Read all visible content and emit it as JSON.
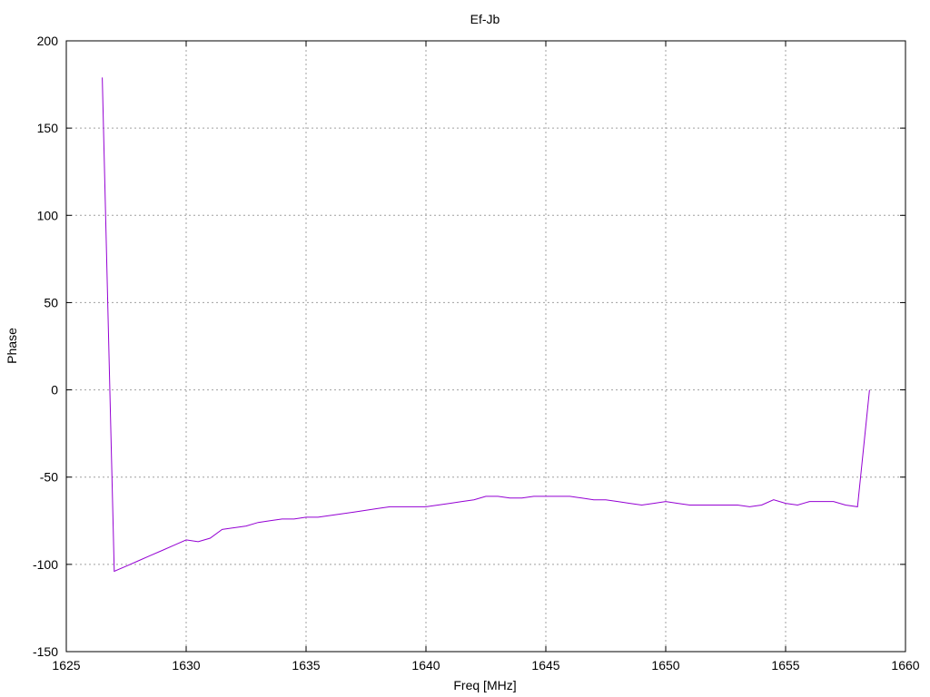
{
  "chart_data": {
    "type": "line",
    "title": "Ef-Jb",
    "xlabel": "Freq [MHz]",
    "ylabel": "Phase",
    "xlim": [
      1625,
      1660
    ],
    "ylim": [
      -150,
      200
    ],
    "xticks": [
      1625,
      1630,
      1635,
      1640,
      1645,
      1650,
      1655,
      1660
    ],
    "yticks": [
      -150,
      -100,
      -50,
      0,
      50,
      100,
      150,
      200
    ],
    "xtick_labels": [
      "1625",
      "1630",
      "1635",
      "1640",
      "1645",
      "1650",
      "1655",
      "1660"
    ],
    "ytick_labels": [
      "-150",
      "-100",
      "-50",
      "0",
      "50",
      "100",
      "150",
      "200"
    ],
    "grid": true,
    "line_color": "#9400d3",
    "series": [
      {
        "x": [
          1626.5,
          1627.0,
          1627.5,
          1628.0,
          1628.5,
          1629.0,
          1629.5,
          1630.0,
          1630.5,
          1631.0,
          1631.5,
          1632.0,
          1632.5,
          1633.0,
          1633.5,
          1634.0,
          1634.5,
          1635.0,
          1635.5,
          1636.0,
          1636.5,
          1637.0,
          1637.5,
          1638.0,
          1638.5,
          1639.0,
          1639.5,
          1640.0,
          1640.5,
          1641.0,
          1641.5,
          1642.0,
          1642.5,
          1643.0,
          1643.5,
          1644.0,
          1644.5,
          1645.0,
          1645.5,
          1646.0,
          1646.5,
          1647.0,
          1647.5,
          1648.0,
          1648.5,
          1649.0,
          1649.5,
          1650.0,
          1650.5,
          1651.0,
          1651.5,
          1652.0,
          1652.5,
          1653.0,
          1653.5,
          1654.0,
          1654.5,
          1655.0,
          1655.5,
          1656.0,
          1656.5,
          1657.0,
          1657.5,
          1658.0,
          1658.5
        ],
        "y": [
          179,
          -104,
          -101,
          -98,
          -95,
          -92,
          -89,
          -86,
          -87,
          -85,
          -80,
          -79,
          -78,
          -76,
          -75,
          -74,
          -74,
          -73,
          -73,
          -72,
          -71,
          -70,
          -69,
          -68,
          -67,
          -67,
          -67,
          -67,
          -66,
          -65,
          -64,
          -63,
          -61,
          -61,
          -62,
          -62,
          -61,
          -61,
          -61,
          -61,
          -62,
          -63,
          -63,
          -64,
          -65,
          -66,
          -65,
          -64,
          -65,
          -66,
          -66,
          -66,
          -66,
          -66,
          -67,
          -66,
          -63,
          -65,
          -66,
          -64,
          -64,
          -64,
          -66,
          -67,
          0
        ]
      }
    ]
  }
}
